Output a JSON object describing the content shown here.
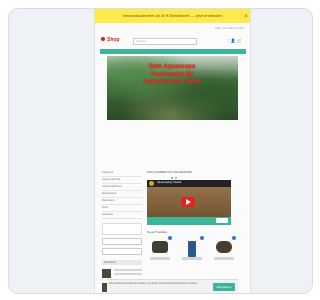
{
  "announcement": {
    "text": "Versandkostenfrei ab 49 € Bestellwert — jetzt entdecken",
    "close_label": "×"
  },
  "top_links": "Hilfe | Kontakt | Konto",
  "header": {
    "logo_text": "Shop",
    "search_placeholder": "Suchen…",
    "icons": "♡ 👤 🛒"
  },
  "hero": {
    "text": "Dein Aquascape Fachhandel für Aquarium und Teich"
  },
  "sidebar": {
    "items": [
      "Aquarium",
      "Aquarientechnik",
      "Aquarienpflanzen",
      "Bodengrund",
      "Dekoration",
      "Teich",
      "Angebote"
    ],
    "heading": "Neuheiten"
  },
  "main": {
    "section_title": "WILLKOMMEN IM ONLINESHOP",
    "video_title": "Aquascaping Tutorial",
    "products_title": "Neue Produkte"
  },
  "cookie": {
    "text": "Diese Webseite verwendet Cookies, um Ihnen das beste Einkaufserlebnis zu bieten.",
    "accept_label": "Akzeptieren"
  },
  "colors": {
    "accent": "#3bb49a",
    "announcement": "#ffe94d",
    "hero_text": "#ff3a2a"
  }
}
